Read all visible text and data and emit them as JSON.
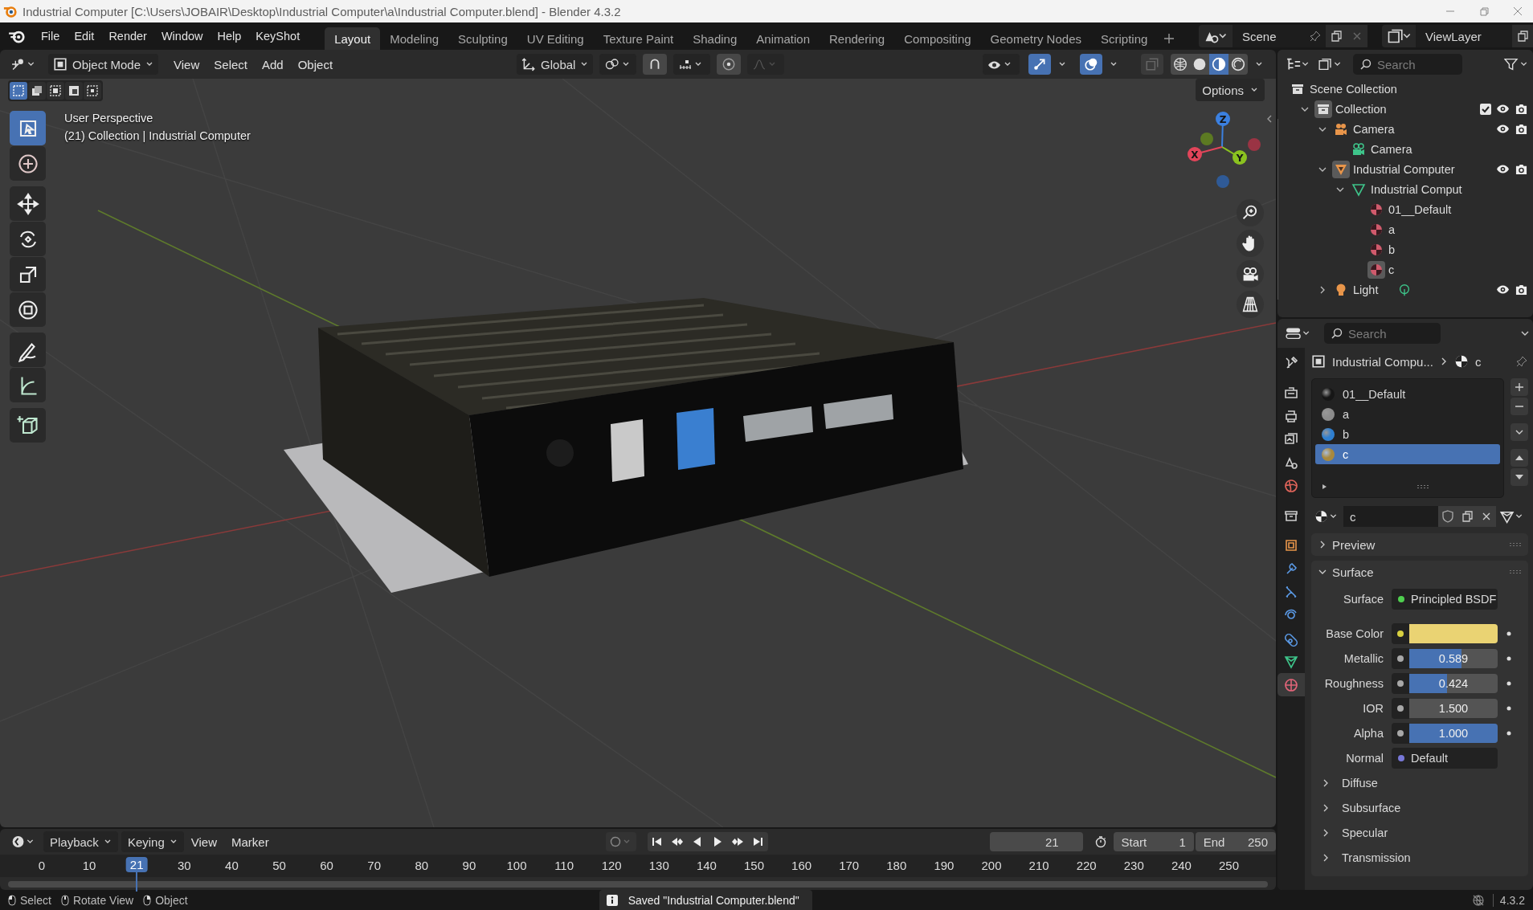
{
  "window": {
    "title": "Industrial Computer [C:\\Users\\JOBAIR\\Desktop\\Industrial Computer\\a\\Industrial Computer.blend] - Blender 4.3.2"
  },
  "menu": [
    "File",
    "Edit",
    "Render",
    "Window",
    "Help",
    "KeyShot"
  ],
  "workspaces": [
    {
      "label": "Layout",
      "selected": true
    },
    {
      "label": "Modeling",
      "selected": false
    },
    {
      "label": "Sculpting",
      "selected": false
    },
    {
      "label": "UV Editing",
      "selected": false
    },
    {
      "label": "Texture Paint",
      "selected": false
    },
    {
      "label": "Shading",
      "selected": false
    },
    {
      "label": "Animation",
      "selected": false
    },
    {
      "label": "Rendering",
      "selected": false
    },
    {
      "label": "Compositing",
      "selected": false
    },
    {
      "label": "Geometry Nodes",
      "selected": false
    },
    {
      "label": "Scripting",
      "selected": false
    }
  ],
  "scene": "Scene",
  "view_layer": "ViewLayer",
  "viewport": {
    "mode": "Object Mode",
    "menus": [
      "View",
      "Select",
      "Add",
      "Object"
    ],
    "orientation": "Global",
    "show_gizmos": true,
    "show_overlays": true,
    "xray": false,
    "shading_modes": [
      {
        "selected": false
      },
      {
        "selected": false
      },
      {
        "selected": true
      },
      {
        "selected": false
      }
    ],
    "select_modes": [
      {
        "selected": true
      },
      {
        "selected": false
      },
      {
        "selected": false
      },
      {
        "selected": false
      },
      {
        "selected": false
      }
    ],
    "options": "Options",
    "info": [
      "User Perspective",
      "(21) Collection | Industrial Computer"
    ],
    "axes": [
      {
        "label": "X",
        "color": "#e2455a"
      },
      {
        "label": "Y",
        "color": "#8bc220"
      },
      {
        "label": "Z",
        "color": "#3b80e0"
      }
    ],
    "tools": [
      {
        "selected": true
      },
      {
        "selected": false
      },
      {
        "selected": false
      },
      {
        "selected": false
      },
      {
        "selected": false
      },
      {
        "selected": false
      },
      {
        "selected": false
      },
      {
        "selected": false
      },
      {
        "selected": false
      }
    ]
  },
  "outliner": {
    "search_placeholder": "Search",
    "tree": [
      {
        "label": "Scene Collection",
        "kind": "scene_collection",
        "active": false,
        "children": [
          {
            "label": "Collection",
            "kind": "collection",
            "expanded": true,
            "active": true,
            "checked": true,
            "visible": true,
            "renderable": true,
            "children": [
              {
                "label": "Camera",
                "kind": "camera_object",
                "expanded": true,
                "active": false,
                "visible": true,
                "renderable": true,
                "children": [
                  {
                    "label": "Camera",
                    "kind": "camera_data",
                    "active": false
                  }
                ]
              },
              {
                "label": "Industrial Computer",
                "kind": "mesh_object",
                "expanded": true,
                "active": true,
                "visible": true,
                "renderable": true,
                "children": [
                  {
                    "label": "Industrial Comput",
                    "kind": "mesh_data",
                    "expanded": true,
                    "active": false,
                    "children": [
                      {
                        "label": "01__Default",
                        "kind": "material",
                        "active": false
                      },
                      {
                        "label": "a",
                        "kind": "material",
                        "active": false
                      },
                      {
                        "label": "b",
                        "kind": "material",
                        "active": false
                      },
                      {
                        "label": "c",
                        "kind": "material",
                        "active": true
                      }
                    ]
                  }
                ]
              },
              {
                "label": "Light",
                "kind": "light_object",
                "expanded": false,
                "active": false,
                "visible": true,
                "renderable": true
              }
            ]
          }
        ]
      }
    ]
  },
  "properties": {
    "search_placeholder": "Search",
    "tabs": [
      {
        "selected": false
      },
      {
        "selected": false
      },
      {
        "selected": false
      },
      {
        "selected": false
      },
      {
        "selected": false
      },
      {
        "selected": false
      },
      {
        "selected": false
      },
      {
        "selected": false
      },
      {
        "selected": false
      },
      {
        "selected": false
      },
      {
        "selected": false
      },
      {
        "selected": false
      },
      {
        "selected": false
      },
      {
        "selected": true
      }
    ],
    "breadcrumb": {
      "object": "Industrial Compu...",
      "material": "c"
    },
    "slots": [
      {
        "name": "01__Default",
        "color": "#161616",
        "selected": false
      },
      {
        "name": "a",
        "color": "#8c8c8c",
        "selected": false
      },
      {
        "name": "b",
        "color": "#2f7fd0",
        "selected": false
      },
      {
        "name": "c",
        "color": "#a8893e",
        "selected": true
      }
    ],
    "material": "c",
    "panels": [
      {
        "label": "Preview",
        "expanded": false
      },
      {
        "label": "Surface",
        "expanded": true
      }
    ],
    "surface": [
      {
        "kind": "link",
        "label": "Surface",
        "value": "Principled BSDF",
        "color": "#4fcf4f"
      },
      {
        "kind": "color",
        "label": "Base Color",
        "color": "#ead373"
      },
      {
        "kind": "slider",
        "label": "Metallic",
        "value": "0.589",
        "level": 0.589,
        "color": "#a8a8a8"
      },
      {
        "kind": "slider",
        "label": "Roughness",
        "value": "0.424",
        "level": 0.424,
        "color": "#a8a8a8"
      },
      {
        "kind": "number",
        "label": "IOR",
        "value": "1.500",
        "color": "#a8a8a8"
      },
      {
        "kind": "slider",
        "label": "Alpha",
        "value": "1.000",
        "level": 1,
        "color": "#a8a8a8"
      },
      {
        "kind": "link",
        "label": "Normal",
        "value": "Default",
        "color": "#7878d8"
      }
    ],
    "subpanels": [
      {
        "label": "Diffuse",
        "expanded": false
      },
      {
        "label": "Subsurface",
        "expanded": false
      },
      {
        "label": "Specular",
        "expanded": false
      },
      {
        "label": "Transmission",
        "expanded": false
      }
    ]
  },
  "timeline": {
    "menus": [
      {
        "label": "Playback",
        "dropdown": true
      },
      {
        "label": "Keying",
        "dropdown": true
      },
      {
        "label": "View",
        "dropdown": false
      },
      {
        "label": "Marker",
        "dropdown": false
      }
    ],
    "auto_keying": false,
    "frame": "21",
    "start_label": "Start",
    "start": "1",
    "end_label": "End",
    "end": "250",
    "ruler": [
      {
        "label": "0",
        "current": false
      },
      {
        "label": "10",
        "current": false
      },
      {
        "label": "21",
        "current": true
      },
      {
        "label": "30",
        "current": false
      },
      {
        "label": "40",
        "current": false
      },
      {
        "label": "50",
        "current": false
      },
      {
        "label": "60",
        "current": false
      },
      {
        "label": "70",
        "current": false
      },
      {
        "label": "80",
        "current": false
      },
      {
        "label": "90",
        "current": false
      },
      {
        "label": "100",
        "current": false
      },
      {
        "label": "110",
        "current": false
      },
      {
        "label": "120",
        "current": false
      },
      {
        "label": "130",
        "current": false
      },
      {
        "label": "140",
        "current": false
      },
      {
        "label": "150",
        "current": false
      },
      {
        "label": "160",
        "current": false
      },
      {
        "label": "170",
        "current": false
      },
      {
        "label": "180",
        "current": false
      },
      {
        "label": "190",
        "current": false
      },
      {
        "label": "200",
        "current": false
      },
      {
        "label": "210",
        "current": false
      },
      {
        "label": "220",
        "current": false
      },
      {
        "label": "230",
        "current": false
      },
      {
        "label": "240",
        "current": false
      },
      {
        "label": "250",
        "current": false
      }
    ]
  },
  "status_bar": {
    "hints": [
      "Select",
      "Rotate View",
      "Object"
    ],
    "message": "Saved \"Industrial Computer.blend\"",
    "version": "4.3.2"
  }
}
